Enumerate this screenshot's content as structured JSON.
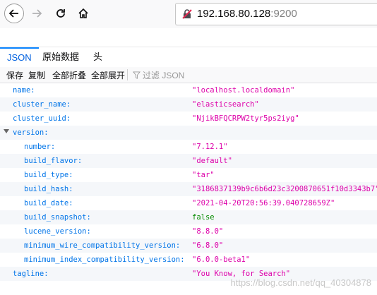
{
  "browser": {
    "url_host": "192.168.80.128",
    "url_port": ":9200"
  },
  "viewer": {
    "tabs": [
      "JSON",
      "原始数据",
      "头"
    ],
    "actions": [
      "保存",
      "复制",
      "全部折叠",
      "全部展开"
    ],
    "filter_placeholder": "过滤 JSON"
  },
  "rows": [
    {
      "key": "name:",
      "value": "\"localhost.localdomain\"",
      "indent": 0
    },
    {
      "key": "cluster_name:",
      "value": "\"elasticsearch\"",
      "indent": 0
    },
    {
      "key": "cluster_uuid:",
      "value": "\"NjikBFQCRPW2tyr5ps2iyg\"",
      "indent": 0
    },
    {
      "key": "version:",
      "value": "",
      "indent": 0,
      "expandable": true
    },
    {
      "key": "number:",
      "value": "\"7.12.1\"",
      "indent": 1
    },
    {
      "key": "build_flavor:",
      "value": "\"default\"",
      "indent": 1
    },
    {
      "key": "build_type:",
      "value": "\"tar\"",
      "indent": 1
    },
    {
      "key": "build_hash:",
      "value": "\"3186837139b9c6b6d23c3200870651f10d3343b7\"",
      "indent": 1
    },
    {
      "key": "build_date:",
      "value": "\"2021-04-20T20:56:39.040728659Z\"",
      "indent": 1
    },
    {
      "key": "build_snapshot:",
      "value": "false",
      "indent": 1,
      "type": "bool"
    },
    {
      "key": "lucene_version:",
      "value": "\"8.8.0\"",
      "indent": 1
    },
    {
      "key": "minimum_wire_compatibility_version:",
      "value": "\"6.8.0\"",
      "indent": 1
    },
    {
      "key": "minimum_index_compatibility_version:",
      "value": "\"6.0.0-beta1\"",
      "indent": 1
    },
    {
      "key": "tagline:",
      "value": "\"You Know, for Search\"",
      "indent": 0
    }
  ],
  "watermark": "https://blog.csdn.net/qq_40304878"
}
